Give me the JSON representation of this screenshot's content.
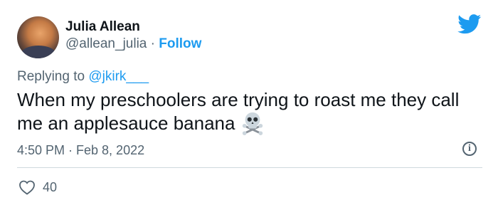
{
  "tweet": {
    "author_name": "Julia Allean",
    "handle": "@allean_julia",
    "separator": " · ",
    "follow_label": "Follow",
    "replying_prefix": "Replying to ",
    "replying_to": "@jkirk___",
    "text": "When my preschoolers are trying to roast me they call me an applesauce banana",
    "timestamp": "4:50 PM · Feb 8, 2022",
    "info_glyph": "i",
    "like_count": "40"
  },
  "icons": {
    "brand": "twitter-bird-icon",
    "emoji": "skull-crossbones-icon",
    "info": "info-icon",
    "like": "heart-icon"
  },
  "colors": {
    "accent": "#1d9bf0",
    "secondary_text": "#536471",
    "primary_text": "#0f1419",
    "divider": "#cfd9de"
  }
}
